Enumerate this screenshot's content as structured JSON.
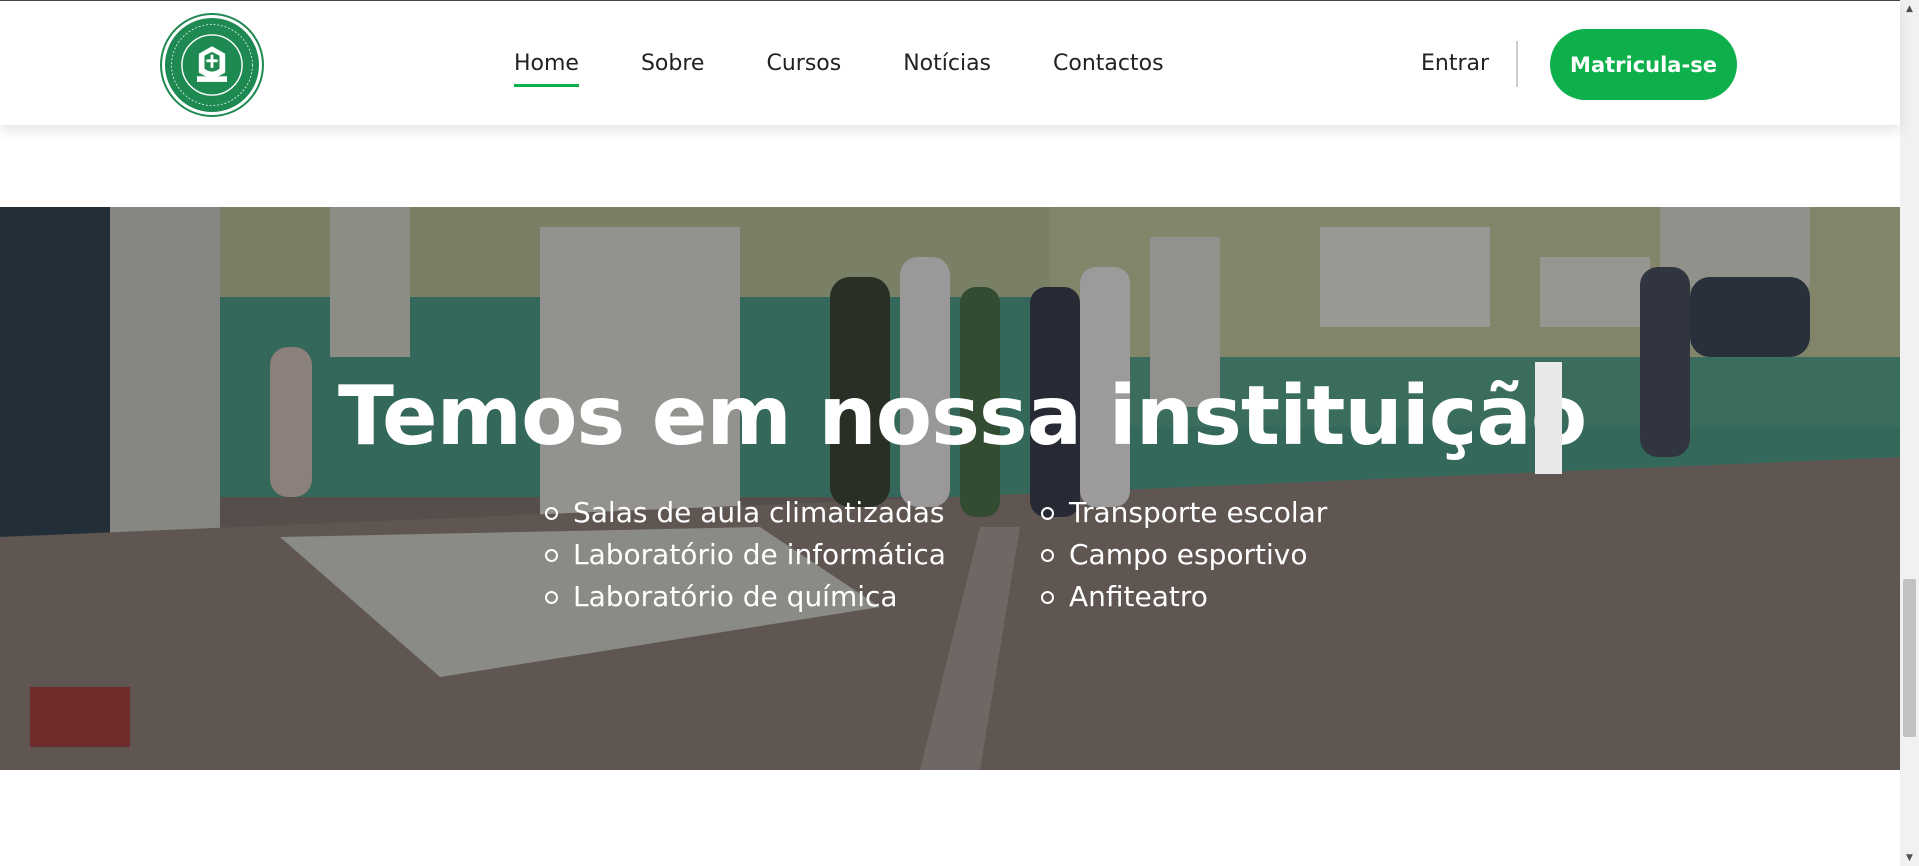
{
  "header": {
    "logo_alt": "COMPLEXO ESCOLAR PRIVADO BAPTISTA DA PAZ",
    "nav": [
      {
        "label": "Home",
        "active": true
      },
      {
        "label": "Sobre",
        "active": false
      },
      {
        "label": "Cursos",
        "active": false
      },
      {
        "label": "Notícias",
        "active": false
      },
      {
        "label": "Contactos",
        "active": false
      }
    ],
    "login_label": "Entrar",
    "cta_label": "Matricula-se"
  },
  "hero": {
    "headline": "Temos em nossa instituição",
    "features_left": [
      "Salas de aula climatizadas",
      "Laboratório de informática",
      "Laboratório de química"
    ],
    "features_right": [
      "Transporte escolar",
      "Campo esportivo",
      "Anfiteatro"
    ]
  },
  "colors": {
    "brand_green": "#0db04b",
    "logo_green": "#1e8a52",
    "text_dark": "#222222"
  },
  "icons": {
    "logo": "school-emblem-icon",
    "bullet": "circle-outline-icon"
  }
}
